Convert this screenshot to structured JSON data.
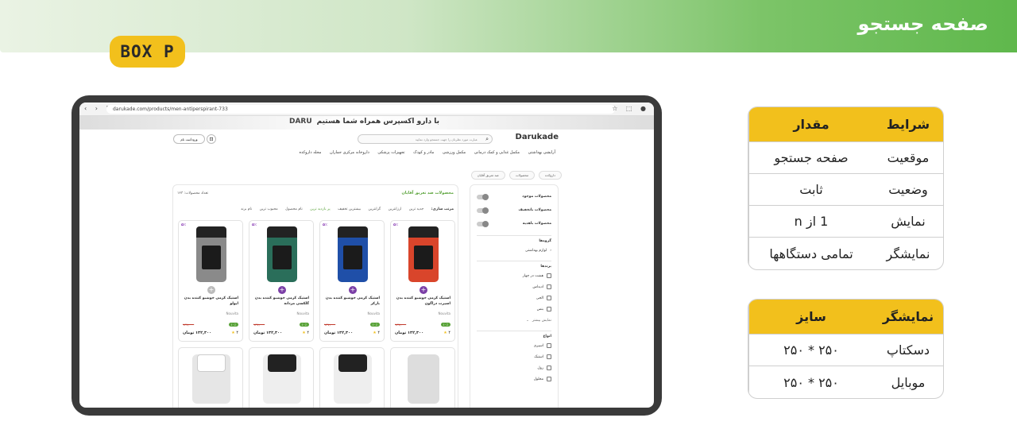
{
  "page_title": "صفحه جستجو",
  "badge": "BOX P",
  "browser": {
    "url": "darukade.com/products/men-antiperspirant-733"
  },
  "site": {
    "banner_text": "با دارو اکسپرس همراه شما هستیم",
    "banner_brand": "DARU",
    "logo": "Darukade",
    "search_placeholder": "عبارت مورد نظرتان را جهت جستجو وارد نمایید",
    "account_label": "ورود/ثبت نام",
    "categories": [
      "آرایشی بهداشتی",
      "مکمل غذایی و کمک درمانی",
      "مکمل ورزشی",
      "مادر و کودک",
      "تجهیزات پزشکی",
      "داروخانه مرکزی جماران",
      "مجله داروکده"
    ],
    "breadcrumbs": [
      "داروکده",
      "محصولات",
      "ضد تعریق آقایان"
    ],
    "main_title": "محصولات ضد تعریق آقایان",
    "product_count": "تعداد محصولات: ۱۲۳",
    "sort_label": "مرتب سازی:",
    "sort_options": [
      "جدید ترین",
      "ارزانترین",
      "گرانترین",
      "بیشترین تخفیف",
      "پر بازدید ترین",
      "نام محصول",
      "محبوب ترین",
      "نام برند"
    ],
    "sidebar": {
      "toggles": [
        "محصولات موجود",
        "محصولات باتخفیف",
        "محصولات باهدیه"
      ],
      "groups_title": "گروه‌ها",
      "group_item": "لوازم بهداشتی",
      "brands_title": "برندها",
      "brands": [
        "هشت در چهار",
        "ادیداس",
        "الجی",
        "بنس"
      ],
      "show_more": "نمایش بیشتر",
      "types_title": "انواع",
      "types": [
        "اسپری",
        "استیک",
        "رول",
        "محلول"
      ]
    },
    "products": [
      {
        "name": "استیک کرمی خوشبو کننده بدن اسپرت دراگون",
        "brand": "Nouvita",
        "discount": "۵٪",
        "off": "۱۰٪",
        "old_price": "۱۴۷,۰۰۰",
        "price": "۱۳۲,۳۰۰ تومان",
        "rating": "۴",
        "color": "#d9452b"
      },
      {
        "name": "استیک کرمی خوشبو کننده بدن بارکر",
        "brand": "Nouvita",
        "discount": "۵٪",
        "off": "۱۰٪",
        "old_price": "۱۴۷,۰۰۰",
        "price": "۱۳۲,۳۰۰ تومان",
        "rating": "۴",
        "color": "#1f4fa8"
      },
      {
        "name": "استیک کرمی خوشبو کننده بدن گلکسی مردانه",
        "brand": "Nouvita",
        "discount": "۵٪",
        "off": "۱۰٪",
        "old_price": "۱۴۷,۰۰۰",
        "price": "۱۳۲,۳۰۰ تومان",
        "rating": "۴",
        "color": "#2a6e5a"
      },
      {
        "name": "استیک کرمی خوشبو کننده بدن اپولو",
        "brand": "Nouvita",
        "discount": "۵٪",
        "off": "۱۰٪",
        "old_price": "۱۴۷,۰۰۰",
        "price": "۱۳۲,۳۰۰ تومان",
        "rating": "۴",
        "color": "#8a8a8a"
      }
    ]
  },
  "table1": {
    "headers": [
      "شرایط",
      "مقدار"
    ],
    "rows": [
      [
        "موقعیت",
        "صفحه جستجو"
      ],
      [
        "وضعیت",
        "ثابت"
      ],
      [
        "نمایش",
        "1 از n"
      ],
      [
        "نمایشگر",
        "تمامی دستگاهها"
      ]
    ]
  },
  "table2": {
    "headers": [
      "نمایشگر",
      "سایز"
    ],
    "rows": [
      [
        "دسکتاپ",
        "۲۵۰ * ۲۵۰"
      ],
      [
        "موبایل",
        "۲۵۰ * ۲۵۰"
      ]
    ]
  }
}
